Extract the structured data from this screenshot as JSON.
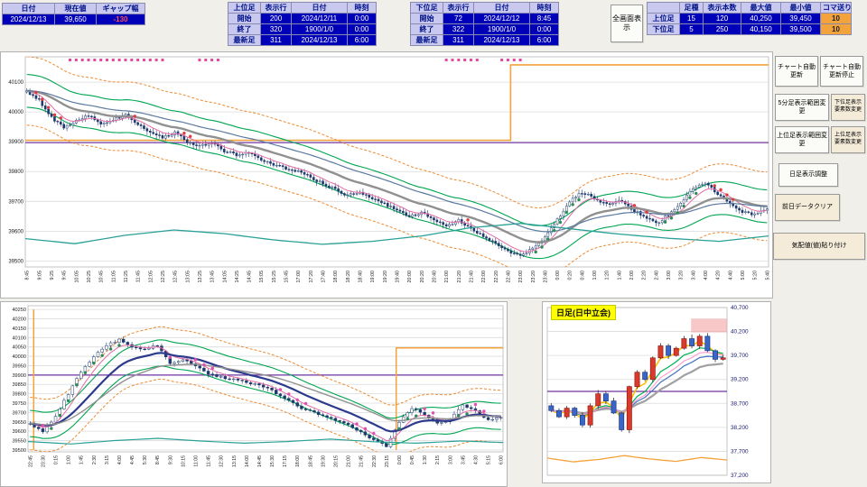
{
  "header": {
    "info_table": {
      "headers": [
        "日付",
        "現在値",
        "ギャップ幅"
      ],
      "values": [
        "2024/12/13",
        "39,650",
        "-130"
      ]
    },
    "upper_table": {
      "title": "上位足",
      "col_headers": [
        "表示行",
        "日付",
        "時刻"
      ],
      "rows": [
        {
          "label": "開始",
          "cells": [
            "200",
            "2024/12/11",
            "0:00"
          ]
        },
        {
          "label": "終了",
          "cells": [
            "320",
            "1900/1/0",
            "0:00"
          ]
        },
        {
          "label": "最新足",
          "cells": [
            "311",
            "2024/12/13",
            "6:00"
          ]
        }
      ]
    },
    "lower_table": {
      "title": "下位足",
      "col_headers": [
        "表示行",
        "日付",
        "時刻"
      ],
      "rows": [
        {
          "label": "開始",
          "cells": [
            "72",
            "2024/12/12",
            "8:45"
          ]
        },
        {
          "label": "終了",
          "cells": [
            "322",
            "1900/1/0",
            "0:00"
          ]
        },
        {
          "label": "最新足",
          "cells": [
            "311",
            "2024/12/13",
            "6:00"
          ]
        }
      ]
    },
    "fullscreen_button": "全画面表示",
    "settings_table": {
      "col_headers": [
        "足種",
        "表示本数",
        "最大値",
        "最小値",
        "コマ送り幅"
      ],
      "rows": [
        {
          "label": "上位足",
          "cells": [
            "15",
            "120",
            "40,250",
            "39,450",
            "10"
          ]
        },
        {
          "label": "下位足",
          "cells": [
            "5",
            "250",
            "40,150",
            "39,500",
            "10"
          ]
        }
      ]
    }
  },
  "sidebar": {
    "buttons": [
      {
        "label": "チャート自動更新"
      },
      {
        "label": "チャート自動更新停止"
      },
      {
        "label": "5分足表示範囲変更"
      },
      {
        "label": "下位足表示要素数変更"
      },
      {
        "label": "上位足表示範囲変更"
      },
      {
        "label": "上位足表示要素数変更"
      },
      {
        "label": "日足表示調整"
      },
      {
        "label": "前日データクリア"
      },
      {
        "label": "気配値(値)貼り付け"
      }
    ]
  },
  "colors": {
    "accent_blue": "#0000b8",
    "header_lavender": "#c9c9f0",
    "gap_red": "#ff5050",
    "step_orange": "#f4a23a",
    "signal_red": "#e03c3c",
    "signal_green": "#2e8b57",
    "marker_magenta": "#e548a0"
  },
  "chart_data": [
    {
      "type": "candlestick",
      "name": "lower-timeframe-5min",
      "y_min": 39480,
      "y_max": 40185,
      "ytick_font": 6,
      "xtick_font": 5.4,
      "y_ticks": [
        [
          40100,
          "40100"
        ],
        [
          40000,
          "40000"
        ],
        [
          39900,
          "39900"
        ],
        [
          39800,
          "39800"
        ],
        [
          39700,
          "39700"
        ],
        [
          39600,
          "39600"
        ],
        [
          39500,
          "39500"
        ]
      ],
      "x_labels": [
        "8:45",
        "9:05",
        "9:25",
        "9:45",
        "10:05",
        "10:25",
        "10:45",
        "11:05",
        "11:25",
        "11:45",
        "12:05",
        "12:25",
        "12:45",
        "13:05",
        "13:25",
        "13:45",
        "14:05",
        "14:25",
        "14:45",
        "15:05",
        "15:25",
        "15:45",
        "17:00",
        "17:20",
        "17:40",
        "18:00",
        "18:20",
        "18:40",
        "19:00",
        "19:20",
        "19:40",
        "20:00",
        "20:20",
        "20:40",
        "21:00",
        "21:20",
        "21:40",
        "22:00",
        "22:20",
        "22:40",
        "23:00",
        "23:20",
        "23:40",
        "0:00",
        "0:20",
        "0:40",
        "1:00",
        "1:20",
        "1:40",
        "2:00",
        "2:20",
        "2:40",
        "3:00",
        "3:20",
        "3:40",
        "4:00",
        "4:20",
        "4:40",
        "5:00",
        "5:20",
        "5:40"
      ],
      "bars_per_label": 4,
      "noise": 9,
      "wick": 14,
      "anchors": [
        40070,
        40040,
        39980,
        39950,
        39970,
        39990,
        39960,
        39975,
        39990,
        39960,
        39930,
        39915,
        39930,
        39900,
        39885,
        39895,
        39870,
        39855,
        39865,
        39840,
        39825,
        39810,
        39800,
        39780,
        39760,
        39740,
        39720,
        39730,
        39710,
        39690,
        39670,
        39650,
        39660,
        39640,
        39620,
        39635,
        39610,
        39585,
        39560,
        39530,
        39515,
        39545,
        39580,
        39640,
        39700,
        39730,
        39710,
        39690,
        39705,
        39675,
        39650,
        39625,
        39655,
        39695,
        39745,
        39760,
        39725,
        39695,
        39665,
        39655,
        39675
      ],
      "margins": {
        "l": 27,
        "t": 5,
        "r": 4,
        "b": 34
      },
      "candle": {
        "up_fill": "#ffffff",
        "down_fill": "#1f3b6e",
        "stroke": "#1f3b6e"
      },
      "emas": [
        {
          "p": 8,
          "c": "#e36ca5",
          "w": 1
        },
        {
          "p": 26,
          "c": "#909090",
          "w": 2.4
        },
        {
          "p": 48,
          "c": "#5b7aa0",
          "w": 1.2
        }
      ],
      "bands": [
        {
          "p": 26,
          "o": 55,
          "c": "#00a550",
          "w": 1.1
        },
        {
          "p": 26,
          "o": -55,
          "c": "#00a550",
          "w": 1.1
        },
        {
          "p": 26,
          "o": 115,
          "c": "#ed8a31",
          "w": 1,
          "d": "3,2"
        },
        {
          "p": 26,
          "o": -115,
          "c": "#ed8a31",
          "w": 1,
          "d": "3,2"
        }
      ],
      "hlines": [
        {
          "v": 39897,
          "c": "#7030a0",
          "w": 1.2
        }
      ],
      "steps": [
        {
          "c": "#f4a23a",
          "w": 1.6,
          "pts": [
            [
              0,
              39905
            ],
            [
              0.653,
              39905
            ],
            [
              0.653,
              40158
            ],
            [
              1,
              40158
            ]
          ]
        }
      ],
      "extra": [
        {
          "c": "#2aa198",
          "w": 1.3,
          "anchors": [
            39575,
            39558,
            39586,
            39604,
            39592,
            39571,
            39556,
            39566,
            39584,
            39612,
            39626,
            39608,
            39590,
            39576,
            39566,
            39584
          ]
        }
      ],
      "signals": {
        "up": "#2e8b57",
        "down": "#e03c3c",
        "th": 22
      },
      "squares": {
        "c": "#e548a0",
        "clusters": [
          [
            0.06,
            0.185
          ],
          [
            0.23,
            0.265
          ],
          [
            0.565,
            0.615
          ],
          [
            0.64,
            0.668
          ]
        ]
      }
    },
    {
      "type": "candlestick",
      "name": "upper-timeframe-15min",
      "y_min": 39490,
      "y_max": 40270,
      "ytick_font": 5.6,
      "xtick_font": 5.2,
      "y_ticks": [
        [
          40250,
          "40250"
        ],
        [
          40200,
          "40200"
        ],
        [
          40150,
          "40150"
        ],
        [
          40100,
          "40100"
        ],
        [
          40050,
          "40050"
        ],
        [
          40000,
          "40000"
        ],
        [
          39950,
          "39950"
        ],
        [
          39900,
          "39900"
        ],
        [
          39850,
          "39850"
        ],
        [
          39800,
          "39800"
        ],
        [
          39750,
          "39750"
        ],
        [
          39700,
          "39700"
        ],
        [
          39650,
          "39650"
        ],
        [
          39600,
          "39600"
        ],
        [
          39550,
          "39550"
        ],
        [
          39500,
          "39500"
        ]
      ],
      "x_labels": [
        "22:45",
        "23:30",
        "0:15",
        "1:00",
        "1:45",
        "2:30",
        "3:15",
        "4:00",
        "4:45",
        "5:30",
        "8:45",
        "9:30",
        "10:15",
        "11:00",
        "11:45",
        "12:30",
        "13:15",
        "14:00",
        "14:45",
        "15:30",
        "17:15",
        "18:00",
        "18:45",
        "19:30",
        "20:15",
        "21:00",
        "21:45",
        "22:30",
        "23:15",
        "0:00",
        "0:45",
        "1:30",
        "2:15",
        "3:00",
        "3:45",
        "4:30",
        "5:15",
        "6:00"
      ],
      "bars_per_label": 3,
      "noise": 11,
      "wick": 18,
      "anchors": [
        39640,
        39600,
        39680,
        39800,
        39920,
        40000,
        40060,
        40090,
        40050,
        40040,
        40060,
        39960,
        39985,
        39950,
        39905,
        39890,
        39875,
        39860,
        39850,
        39815,
        39775,
        39735,
        39705,
        39685,
        39660,
        39635,
        39595,
        39555,
        39520,
        39650,
        39720,
        39690,
        39645,
        39660,
        39745,
        39705,
        39660,
        39675
      ],
      "margins": {
        "l": 30,
        "t": 4,
        "r": 4,
        "b": 38
      },
      "candle": {
        "up_fill": "#ffffff",
        "down_fill": "#1f3b6e",
        "stroke": "#1f3b6e"
      },
      "emas": [
        {
          "p": 6,
          "c": "#e36ca5",
          "w": 1
        },
        {
          "p": 16,
          "c": "#2b3a8c",
          "w": 2.2
        },
        {
          "p": 30,
          "c": "#909090",
          "w": 1.4
        }
      ],
      "bands": [
        {
          "p": 16,
          "o": 70,
          "c": "#00a550",
          "w": 1.1
        },
        {
          "p": 16,
          "o": -70,
          "c": "#00a550",
          "w": 1.1
        },
        {
          "p": 16,
          "o": 140,
          "c": "#ed8a31",
          "w": 1,
          "d": "3,2"
        },
        {
          "p": 16,
          "o": -140,
          "c": "#ed8a31",
          "w": 1,
          "d": "3,2"
        }
      ],
      "hlines": [
        {
          "v": 39900,
          "c": "#7030a0",
          "w": 1.2
        }
      ],
      "steps": [
        {
          "c": "#f4a23a",
          "w": 1.5,
          "pts": [
            [
              0.012,
              39500
            ],
            [
              0.012,
              40250
            ]
          ]
        },
        {
          "c": "#f4a23a",
          "w": 1.5,
          "pts": [
            [
              0.775,
              39500
            ],
            [
              0.775,
              40045
            ],
            [
              1,
              40045
            ]
          ]
        }
      ],
      "extra": [
        {
          "c": "#2aa198",
          "w": 1.2,
          "anchors": [
            39545,
            39532,
            39550,
            39562,
            39548,
            39536,
            39545,
            39558,
            39544,
            39536,
            39548,
            39540
          ]
        }
      ],
      "signals": {
        "up": "#2e8b57",
        "down": "#e04fae",
        "th": 30
      },
      "squares": {
        "c": "#e548a0",
        "clusters": []
      }
    },
    {
      "type": "candlestick",
      "name": "daily-chart",
      "title": "日足(日中立会)",
      "y_min": 37200,
      "y_max": 40700,
      "ytick_font": 6.4,
      "y_ticks": [
        [
          40700,
          "40,700"
        ],
        [
          40200,
          "40,200"
        ],
        [
          39700,
          "39,700"
        ],
        [
          39200,
          "39,200"
        ],
        [
          38700,
          "38,700"
        ],
        [
          38200,
          "38,200"
        ],
        [
          37700,
          "37,700"
        ],
        [
          37200,
          "37,200"
        ]
      ],
      "anchors": [
        38650,
        38550,
        38420,
        38600,
        38450,
        38250,
        38650,
        38900,
        38750,
        38500,
        38150,
        39050,
        39350,
        39200,
        39650,
        39900,
        39700,
        39850,
        40050,
        39900,
        40100,
        39800,
        39620,
        39650
      ],
      "margins": {
        "l": 5,
        "t": 6,
        "r": 48,
        "b": 8
      },
      "wick": 90,
      "candle": {
        "up_fill": "#d93a2b",
        "up_stroke": "#8f1d12",
        "down_fill": "#3a66c8",
        "down_stroke": "#1c3a8a"
      },
      "mas": [
        {
          "p": 3,
          "c": "#ffc000",
          "w": 1.6
        },
        {
          "p": 6,
          "c": "#00b050",
          "w": 1.2
        },
        {
          "p": 10,
          "c": "#4472c4",
          "w": 1.2
        },
        {
          "p": 15,
          "c": "#a0a0a0",
          "w": 2.2
        },
        {
          "p": 8,
          "c": "#ff99cc",
          "w": 1.1
        }
      ],
      "hlines": [
        {
          "v": 38950,
          "c": "#7030a0",
          "w": 1.2
        }
      ],
      "zone": {
        "x0": 0.8,
        "x1": 1.0,
        "y0": 40180,
        "y1": 40470,
        "c": "rgba(243,154,154,0.55)"
      },
      "extra": [
        {
          "c": "#f4a23a",
          "w": 1.3,
          "anchors": [
            37560,
            37480,
            37530,
            37610,
            37540,
            37490,
            37570,
            37520
          ]
        }
      ]
    }
  ]
}
